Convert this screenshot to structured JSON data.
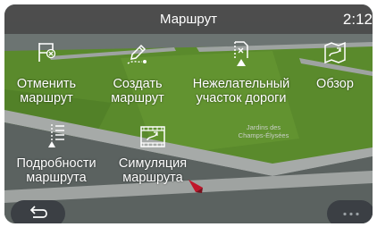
{
  "header": {
    "title": "Маршрут",
    "time": "2:12"
  },
  "menu": {
    "cancel_route": {
      "line1": "Отменить",
      "line2": "маршрут",
      "icon": "flag-cancel-icon"
    },
    "create_route": {
      "line1": "Создать",
      "line2": "маршрут",
      "icon": "route-pencil-icon"
    },
    "avoid_road": {
      "line1": "Нежелательный",
      "line2": "участок дороги",
      "icon": "road-avoid-icon"
    },
    "overview": {
      "line1": "Обзор",
      "icon": "map-overview-icon"
    },
    "route_details": {
      "line1": "Подробности",
      "line2": "маршрута",
      "icon": "route-list-icon"
    },
    "simulation": {
      "line1": "Симуляция",
      "line2": "маршрута",
      "icon": "route-simulation-icon"
    }
  },
  "map": {
    "place_label_line1": "Jardins des",
    "place_label_line2": "Champs-Élysées"
  },
  "footer": {
    "back_icon": "back-arrow-icon",
    "more_icon": "more-dots-icon"
  },
  "colors": {
    "header_bg": "#4a4a4a",
    "button_bg": "#3b3f44",
    "map_green": "#5d8a2e",
    "map_road": "#a9acab",
    "icon_white": "#ffffff"
  }
}
